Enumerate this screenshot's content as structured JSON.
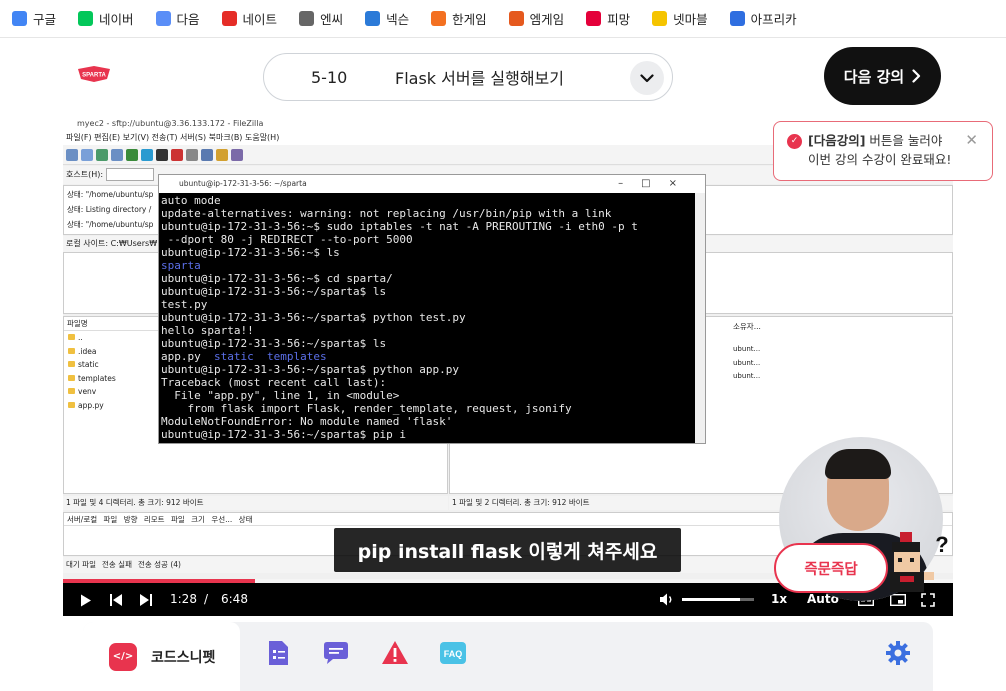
{
  "bookmarks": [
    {
      "label": "구글",
      "icon": "google-icon",
      "color": "#4285f4"
    },
    {
      "label": "네이버",
      "icon": "naver-icon",
      "color": "#03c75a"
    },
    {
      "label": "다음",
      "icon": "daum-icon",
      "color": "#5a8ef7"
    },
    {
      "label": "네이트",
      "icon": "nate-icon",
      "color": "#e52d27"
    },
    {
      "label": "엔씨",
      "icon": "nc-icon",
      "color": "#666666"
    },
    {
      "label": "넥슨",
      "icon": "nexon-icon",
      "color": "#2b7ad8"
    },
    {
      "label": "한게임",
      "icon": "hangame-icon",
      "color": "#f37021"
    },
    {
      "label": "엠게임",
      "icon": "mgame-icon",
      "color": "#e5591e"
    },
    {
      "label": "피망",
      "icon": "pmang-icon",
      "color": "#e4003a"
    },
    {
      "label": "넷마블",
      "icon": "netmarble-icon",
      "color": "#f5c400"
    },
    {
      "label": "아프리카",
      "icon": "afreeca-icon",
      "color": "#2f6ee0"
    }
  ],
  "header": {
    "logo_text": "SPARTA",
    "lesson_number": "5-10",
    "lesson_title": "Flask 서버를 실행해보기",
    "next_label": "다음 강의"
  },
  "tooltip": {
    "highlight": "[다음강의]",
    "line1_rest": " 버튼을 눌러야",
    "line2": "이번 강의 수강이 완료돼요!"
  },
  "filezilla": {
    "title": "myec2 - sftp://ubuntu@3.36.133.172 - FileZilla",
    "menu": "파일(F)  편집(E)  보기(V)  전송(T)  서버(S)  북마크(B)  도움말(H)",
    "host_label": "호스트(H):",
    "log": [
      "상태:  \"/home/ubuntu/sp",
      "상태:  Listing directory /",
      "상태:  \"/home/ubuntu/sp"
    ],
    "local_site_label": "로컬 사이트:",
    "local_site_value": "C:₩Users₩",
    "left_header": "파일명",
    "files": [
      "..",
      ".idea",
      "static",
      "templates",
      "venv",
      "app.py"
    ],
    "right_header": "소유자...",
    "owners": [
      "ubunt...",
      "ubunt...",
      "ubunt..."
    ],
    "left_status": "1 파일 및 4 디렉터리. 총 크기: 912 바이트",
    "right_status": "1 파일 및 2 디렉터리. 총 크기: 912 바이트",
    "queue_header": "서버/로컬 파일  방향  리모트 파일  크기  우선...  상태",
    "tabs": [
      "대기 파일",
      "전송 실패",
      "전송 성공 (4)"
    ]
  },
  "terminal": {
    "title": "ubuntu@ip-172-31-3-56: ~/sparta",
    "lines": [
      {
        "text": "auto mode"
      },
      {
        "text": "update-alternatives: warning: not replacing /usr/bin/pip with a link"
      },
      {
        "text": "ubuntu@ip-172-31-3-56:~$ sudo iptables -t nat -A PREROUTING -i eth0 -p t"
      },
      {
        "text": " --dport 80 -j REDIRECT --to-port 5000"
      },
      {
        "text": "ubuntu@ip-172-31-3-56:~$ ls"
      },
      {
        "text": "sparta",
        "color": "blue"
      },
      {
        "text": "ubuntu@ip-172-31-3-56:~$ cd sparta/"
      },
      {
        "text": "ubuntu@ip-172-31-3-56:~/sparta$ ls"
      },
      {
        "text": "test.py"
      },
      {
        "text": "ubuntu@ip-172-31-3-56:~/sparta$ python test.py"
      },
      {
        "text": "hello sparta!!"
      },
      {
        "text": "ubuntu@ip-172-31-3-56:~/sparta$ ls"
      },
      {
        "text": "app.py  static  templates",
        "mixed": true
      },
      {
        "text": "ubuntu@ip-172-31-3-56:~/sparta$ python app.py"
      },
      {
        "text": "Traceback (most recent call last):"
      },
      {
        "text": "  File \"app.py\", line 1, in <module>"
      },
      {
        "text": "    from flask import Flask, render_template, request, jsonify"
      },
      {
        "text": "ModuleNotFoundError: No module named 'flask'"
      },
      {
        "text": "ubuntu@ip-172-31-3-56:~/sparta$ pip i"
      }
    ]
  },
  "player": {
    "current_time": "1:28",
    "separator": "/",
    "duration": "6:48",
    "progress": 0.216,
    "volume": 0.8,
    "speed": "1x",
    "quality": "Auto",
    "subtitle": "pip install flask 이렇게 쳐주세요"
  },
  "qa_button": "즉문즉답",
  "bottom_toolbar": {
    "snippet_label": "코드스니펫",
    "faq_label": "FAQ"
  },
  "colors": {
    "accent": "#e8344e",
    "dark": "#111111",
    "terminal_blue": "#5b6fe8"
  }
}
